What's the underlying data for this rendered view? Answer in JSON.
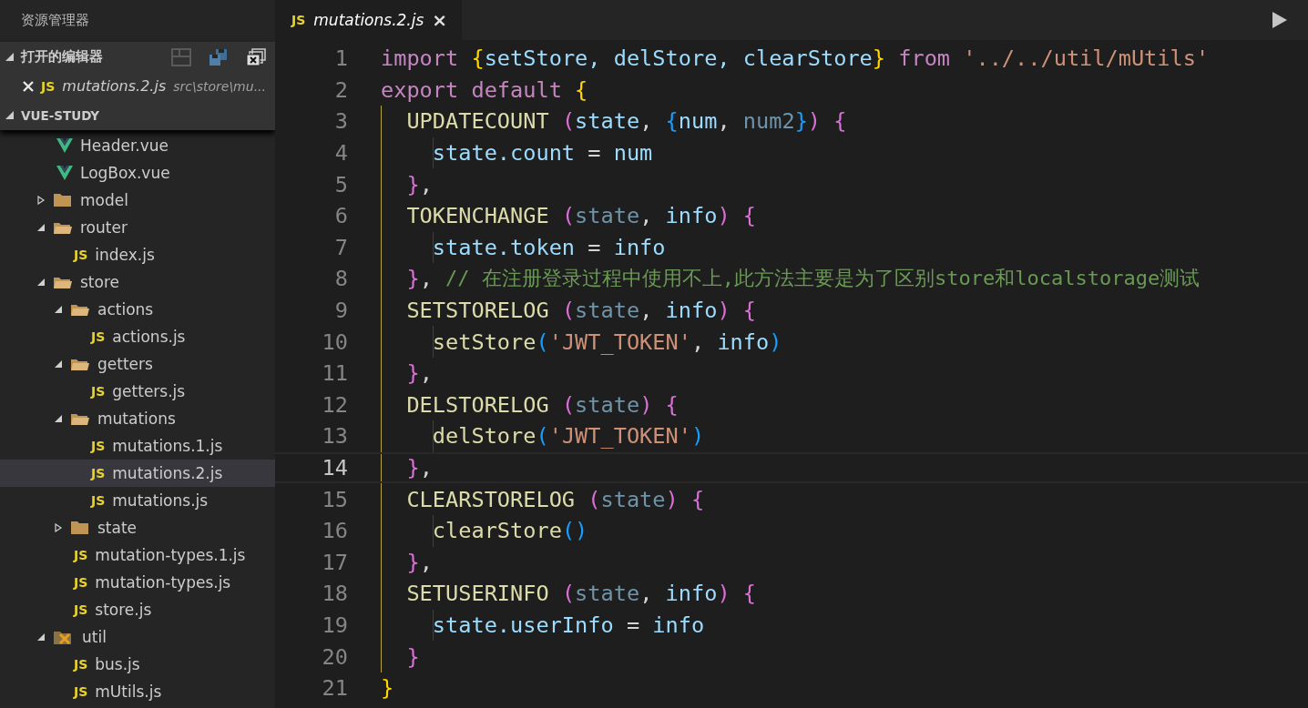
{
  "sidebar": {
    "title": "资源管理器",
    "open_editors": {
      "title": "打开的编辑器",
      "expanded": true,
      "items": [
        {
          "kind": "js",
          "icon": "JS",
          "name": "mutations.2.js",
          "path": "src\\store\\mu...",
          "selected": true
        }
      ]
    },
    "project": {
      "title": "VUE-STUDY",
      "expanded": true
    },
    "tree": [
      {
        "kind": "vue",
        "name": "Header.vue",
        "selected": false
      },
      {
        "kind": "vue",
        "name": "LogBox.vue",
        "selected": false
      },
      {
        "kind": "folder",
        "name": "model",
        "expanded": false,
        "selected": false
      },
      {
        "kind": "folder",
        "name": "router",
        "expanded": true,
        "selected": false,
        "children": [
          {
            "kind": "js",
            "icon": "JS",
            "name": "index.js",
            "selected": false
          }
        ]
      },
      {
        "kind": "folder",
        "name": "store",
        "expanded": true,
        "selected": false,
        "children": [
          {
            "kind": "folder",
            "name": "actions",
            "expanded": true,
            "selected": false,
            "children": [
              {
                "kind": "js",
                "icon": "JS",
                "name": "actions.js",
                "selected": false
              }
            ]
          },
          {
            "kind": "folder",
            "name": "getters",
            "expanded": true,
            "selected": false,
            "children": [
              {
                "kind": "js",
                "icon": "JS",
                "name": "getters.js",
                "selected": false
              }
            ]
          },
          {
            "kind": "folder",
            "name": "mutations",
            "expanded": true,
            "selected": false,
            "children": [
              {
                "kind": "js",
                "icon": "JS",
                "name": "mutations.1.js",
                "selected": false
              },
              {
                "kind": "js",
                "icon": "JS",
                "name": "mutations.2.js",
                "selected": true
              },
              {
                "kind": "js",
                "icon": "JS",
                "name": "mutations.js",
                "selected": false
              }
            ]
          },
          {
            "kind": "folder",
            "name": "state",
            "expanded": false,
            "selected": false
          },
          {
            "kind": "js",
            "icon": "JS",
            "name": "mutation-types.1.js",
            "selected": false
          },
          {
            "kind": "js",
            "icon": "JS",
            "name": "mutation-types.js",
            "selected": false
          },
          {
            "kind": "js",
            "icon": "JS",
            "name": "store.js",
            "selected": false
          }
        ]
      },
      {
        "kind": "tools-folder",
        "name": "util",
        "expanded": true,
        "selected": false,
        "children": [
          {
            "kind": "js",
            "icon": "JS",
            "name": "bus.js",
            "selected": false
          },
          {
            "kind": "js",
            "icon": "JS",
            "name": "mUtils.js",
            "selected": false
          }
        ]
      }
    ]
  },
  "tabs": [
    {
      "kind": "js",
      "icon": "JS",
      "label": "mutations.2.js",
      "close": "×",
      "selected": true
    }
  ],
  "editor": {
    "lines": [
      {
        "number": "1",
        "current": false,
        "tokens": [
          {
            "kind": "keyword",
            "text": "import "
          },
          {
            "kind": "bracket1",
            "text": "{"
          },
          {
            "kind": "variable",
            "text": "setStore, delStore, clearStore"
          },
          {
            "kind": "bracket1",
            "text": "} "
          },
          {
            "kind": "keyword",
            "text": "from "
          },
          {
            "kind": "string",
            "text": "'../../util/mUtils'"
          }
        ]
      },
      {
        "number": "2",
        "current": false,
        "tokens": [
          {
            "kind": "keyword",
            "text": "export default "
          },
          {
            "kind": "bracket1",
            "text": "{"
          }
        ]
      },
      {
        "number": "3",
        "current": false,
        "tokens": [
          {
            "kind": "method",
            "text": "  UPDATECOUNT "
          },
          {
            "kind": "bracket2",
            "text": "("
          },
          {
            "kind": "variable",
            "text": "state"
          },
          {
            "kind": "plain",
            "text": ", "
          },
          {
            "kind": "bracket3",
            "text": "{"
          },
          {
            "kind": "variable",
            "text": "num"
          },
          {
            "kind": "plain",
            "text": ", "
          },
          {
            "kind": "unused",
            "text": "num2"
          },
          {
            "kind": "bracket3",
            "text": "}"
          },
          {
            "kind": "bracket2",
            "text": ") {"
          }
        ]
      },
      {
        "number": "4",
        "current": false,
        "tokens": [
          {
            "kind": "variable",
            "text": "    state.count"
          },
          {
            "kind": "plain",
            "text": " = "
          },
          {
            "kind": "variable",
            "text": "num"
          }
        ]
      },
      {
        "number": "5",
        "current": false,
        "tokens": [
          {
            "kind": "bracket2",
            "text": "  }"
          },
          {
            "kind": "plain",
            "text": ","
          }
        ]
      },
      {
        "number": "6",
        "current": false,
        "tokens": [
          {
            "kind": "method",
            "text": "  TOKENCHANGE "
          },
          {
            "kind": "bracket2",
            "text": "("
          },
          {
            "kind": "unused",
            "text": "state"
          },
          {
            "kind": "plain",
            "text": ", "
          },
          {
            "kind": "variable",
            "text": "info"
          },
          {
            "kind": "bracket2",
            "text": ") {"
          }
        ]
      },
      {
        "number": "7",
        "current": false,
        "tokens": [
          {
            "kind": "variable",
            "text": "    state.token"
          },
          {
            "kind": "plain",
            "text": " = "
          },
          {
            "kind": "variable",
            "text": "info"
          }
        ]
      },
      {
        "number": "8",
        "current": false,
        "tokens": [
          {
            "kind": "bracket2",
            "text": "  }"
          },
          {
            "kind": "plain",
            "text": ", "
          },
          {
            "kind": "comment",
            "text": "// 在注册登录过程中使用不上,此方法主要是为了区别store和localstorage测试"
          }
        ]
      },
      {
        "number": "9",
        "current": false,
        "tokens": [
          {
            "kind": "method",
            "text": "  SETSTORELOG "
          },
          {
            "kind": "bracket2",
            "text": "("
          },
          {
            "kind": "unused",
            "text": "state"
          },
          {
            "kind": "plain",
            "text": ", "
          },
          {
            "kind": "variable",
            "text": "info"
          },
          {
            "kind": "bracket2",
            "text": ") {"
          }
        ]
      },
      {
        "number": "10",
        "current": false,
        "tokens": [
          {
            "kind": "method",
            "text": "    setStore"
          },
          {
            "kind": "bracket3",
            "text": "("
          },
          {
            "kind": "string",
            "text": "'JWT_TOKEN'"
          },
          {
            "kind": "plain",
            "text": ", "
          },
          {
            "kind": "variable",
            "text": "info"
          },
          {
            "kind": "bracket3",
            "text": ")"
          }
        ]
      },
      {
        "number": "11",
        "current": false,
        "tokens": [
          {
            "kind": "bracket2",
            "text": "  }"
          },
          {
            "kind": "plain",
            "text": ","
          }
        ]
      },
      {
        "number": "12",
        "current": false,
        "tokens": [
          {
            "kind": "method",
            "text": "  DELSTORELOG "
          },
          {
            "kind": "bracket2",
            "text": "("
          },
          {
            "kind": "unused",
            "text": "state"
          },
          {
            "kind": "bracket2",
            "text": ") {"
          }
        ]
      },
      {
        "number": "13",
        "current": false,
        "tokens": [
          {
            "kind": "method",
            "text": "    delStore"
          },
          {
            "kind": "bracket3",
            "text": "("
          },
          {
            "kind": "string",
            "text": "'JWT_TOKEN'"
          },
          {
            "kind": "bracket3",
            "text": ")"
          }
        ]
      },
      {
        "number": "14",
        "current": true,
        "tokens": [
          {
            "kind": "bracket2",
            "text": "  }"
          },
          {
            "kind": "plain",
            "text": ","
          }
        ]
      },
      {
        "number": "15",
        "current": false,
        "tokens": [
          {
            "kind": "method",
            "text": "  CLEARSTORELOG "
          },
          {
            "kind": "bracket2",
            "text": "("
          },
          {
            "kind": "unused",
            "text": "state"
          },
          {
            "kind": "bracket2",
            "text": ") {"
          }
        ]
      },
      {
        "number": "16",
        "current": false,
        "tokens": [
          {
            "kind": "method",
            "text": "    clearStore"
          },
          {
            "kind": "bracket3",
            "text": "()"
          }
        ]
      },
      {
        "number": "17",
        "current": false,
        "tokens": [
          {
            "kind": "bracket2",
            "text": "  }"
          },
          {
            "kind": "plain",
            "text": ","
          }
        ]
      },
      {
        "number": "18",
        "current": false,
        "tokens": [
          {
            "kind": "method",
            "text": "  SETUSERINFO "
          },
          {
            "kind": "bracket2",
            "text": "("
          },
          {
            "kind": "unused",
            "text": "state"
          },
          {
            "kind": "plain",
            "text": ", "
          },
          {
            "kind": "variable",
            "text": "info"
          },
          {
            "kind": "bracket2",
            "text": ") {"
          }
        ]
      },
      {
        "number": "19",
        "current": false,
        "tokens": [
          {
            "kind": "variable",
            "text": "    state.userInfo"
          },
          {
            "kind": "plain",
            "text": " = "
          },
          {
            "kind": "variable",
            "text": "info"
          }
        ]
      },
      {
        "number": "20",
        "current": false,
        "tokens": [
          {
            "kind": "bracket2",
            "text": "  }"
          }
        ]
      },
      {
        "number": "21",
        "current": false,
        "tokens": [
          {
            "kind": "bracket1",
            "text": "}"
          }
        ]
      }
    ]
  }
}
